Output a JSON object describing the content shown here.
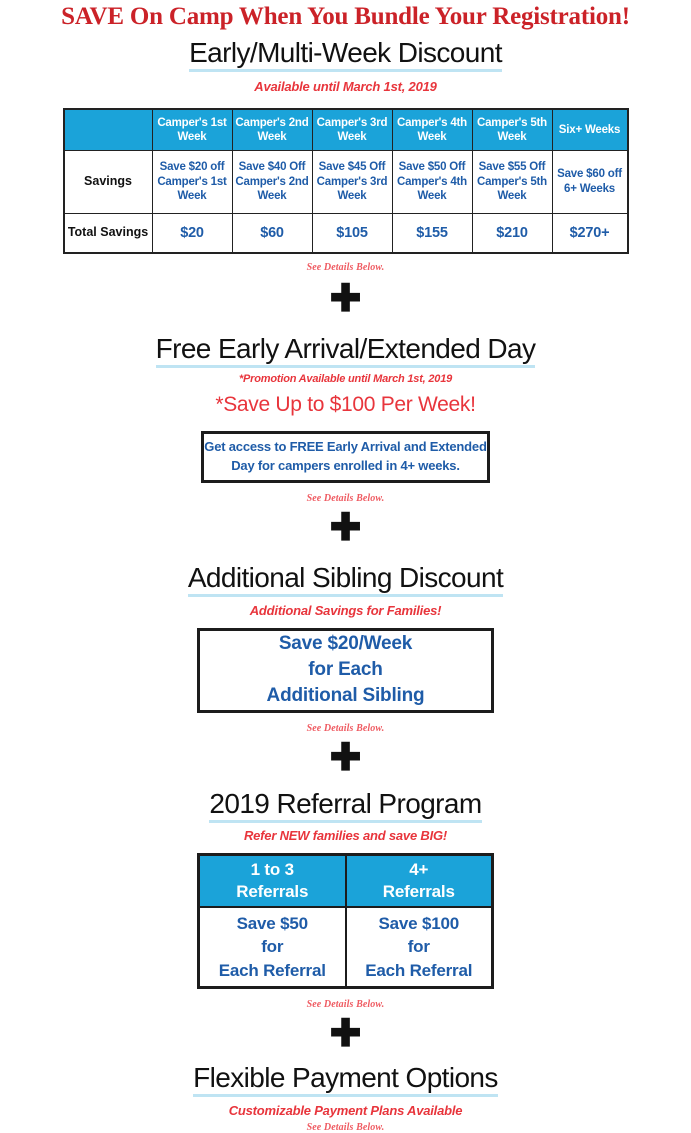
{
  "banner": {
    "headline": "SAVE On Camp When You Bundle Your Registration!"
  },
  "colors": {
    "red": "#cb2228",
    "bright_red": "#e8353c",
    "see_details_red": "#ef5b62",
    "header_blue": "#1ba3d9",
    "text_blue": "#1f5ca8",
    "underline_blue": "#bfe4f3",
    "border_black": "#1c1c1c"
  },
  "common": {
    "see_details": "See Details Below.",
    "plus": "✚"
  },
  "sections": {
    "early_multi_week": {
      "title": "Early/Multi-Week Discount",
      "subtitle": "Available until March 1st, 2019",
      "table": {
        "headers": [
          "",
          "Camper's 1st Week",
          "Camper's 2nd Week",
          "Camper's 3rd Week",
          "Camper's 4th Week",
          "Camper's 5th Week",
          "Six+ Weeks"
        ],
        "rows": [
          {
            "label": "Savings",
            "cells": [
              "Save $20 off Camper's 1st Week",
              "Save $40 Off Camper's 2nd Week",
              "Save $45 Off Camper's 3rd Week",
              "Save $50 Off Camper's 4th Week",
              "Save $55 Off Camper's 5th Week",
              "Save $60 off 6+ Weeks"
            ]
          },
          {
            "label": "Total Savings",
            "cells": [
              "$20",
              "$60",
              "$105",
              "$155",
              "$210",
              "$270+"
            ]
          }
        ]
      }
    },
    "early_arrival": {
      "title": "Free Early Arrival/Extended Day",
      "subtitle": "*Promotion Available until March 1st, 2019",
      "highlight": "*Save Up to $100 Per Week!",
      "box_text": "Get access to FREE Early Arrival and Extended Day for campers enrolled in 4+ weeks."
    },
    "sibling": {
      "title": "Additional Sibling Discount",
      "subtitle": "Additional Savings for Families!",
      "box_line1": "Save $20/Week",
      "box_line2": "for Each",
      "box_line3": "Additional Sibling"
    },
    "referral": {
      "title": "2019 Referral Program",
      "subtitle": "Refer NEW families and save BIG!",
      "columns": [
        {
          "header_line1": "1 to 3",
          "header_line2": "Referrals",
          "body_line1": "Save $50",
          "body_line2": "for",
          "body_line3": "Each Referral"
        },
        {
          "header_line1": "4+",
          "header_line2": "Referrals",
          "body_line1": "Save $100",
          "body_line2": "for",
          "body_line3": "Each Referral"
        }
      ]
    },
    "payment": {
      "title": "Flexible Payment Options",
      "subtitle": "Customizable Payment Plans Available"
    }
  }
}
